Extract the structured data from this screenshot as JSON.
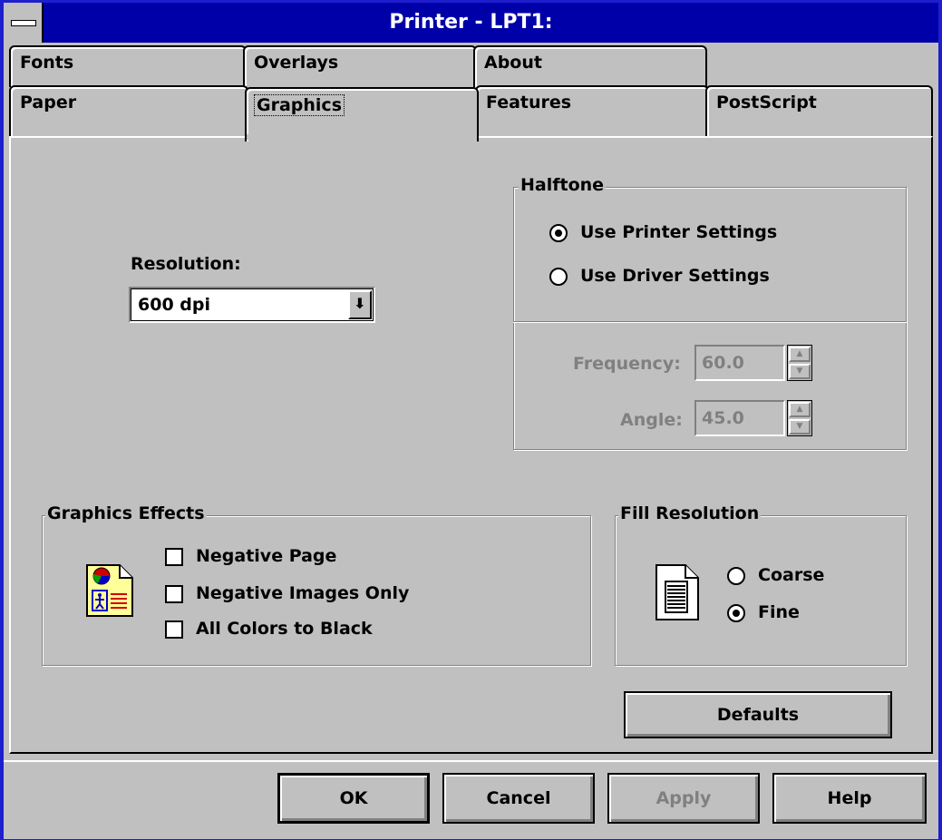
{
  "window": {
    "title": "Printer - LPT1:"
  },
  "tabs": {
    "fonts": "Fonts",
    "overlays": "Overlays",
    "about": "About",
    "paper": "Paper",
    "graphics": "Graphics",
    "features": "Features",
    "postscript": "PostScript",
    "active": "Graphics"
  },
  "resolution": {
    "label": "Resolution:",
    "value": "600 dpi"
  },
  "halftone": {
    "group_label": "Halftone",
    "use_printer_settings": "Use Printer Settings",
    "use_driver_settings": "Use Driver Settings",
    "selected": "Use Printer Settings",
    "frequency_label": "Frequency:",
    "frequency_value": "60.0",
    "angle_label": "Angle:",
    "angle_value": "45.0"
  },
  "graphics_effects": {
    "group_label": "Graphics Effects",
    "negative_page": "Negative Page",
    "negative_images_only": "Negative Images Only",
    "all_colors_to_black": "All Colors to Black",
    "negative_page_checked": false,
    "negative_images_only_checked": false,
    "all_colors_to_black_checked": false
  },
  "fill_resolution": {
    "group_label": "Fill Resolution",
    "coarse": "Coarse",
    "fine": "Fine",
    "selected": "Fine"
  },
  "buttons": {
    "defaults": "Defaults",
    "ok": "OK",
    "cancel": "Cancel",
    "apply": "Apply",
    "help": "Help"
  },
  "icons": {
    "system_menu": "system-menu-icon",
    "dropdown_arrow": "dropdown-arrow-icon",
    "graphics_page": "graphics-page-icon",
    "fill_page": "document-lines-icon",
    "spinner": "spinner-arrows-icon"
  },
  "colors": {
    "titlebar": "#0000a8",
    "face": "#c0c0c0",
    "shadow": "#808080"
  }
}
